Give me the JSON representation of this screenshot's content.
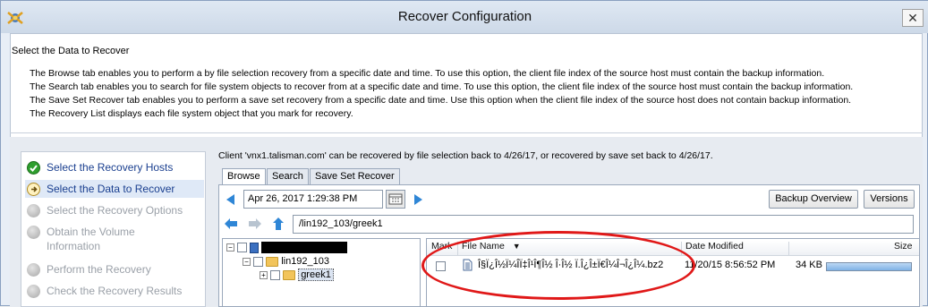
{
  "window": {
    "title": "Recover Configuration",
    "close_glyph": "✕"
  },
  "header": {
    "section_title": "Select the Data to Recover",
    "descriptions": [
      "The Browse tab enables you to perform a by file selection recovery from a specific date and time. To use this option, the client file index of the source host must contain the backup information.",
      "The Search tab enables you to search for file system objects to recover from at a specific date and time. To use this option, the client file index of the source host must contain the backup information.",
      "The Save Set Recover tab enables you to perform a save set recovery from a specific date and time.  Use this option when the client file index of the source host does not contain backup information.",
      "The Recovery List displays each file system object that you mark for recovery."
    ]
  },
  "steps": [
    {
      "label": "Select the Recovery Hosts",
      "state": "done",
      "icon": "check-circle-icon"
    },
    {
      "label": "Select the Data to Recover",
      "state": "active",
      "icon": "current-step-icon"
    },
    {
      "label": "Select the Recovery Options",
      "state": "disabled",
      "icon": "pending-step-icon"
    },
    {
      "label": "Obtain the Volume",
      "label2": "Information",
      "state": "disabled",
      "icon": "pending-step-icon"
    },
    {
      "label": "Perform the Recovery",
      "state": "disabled",
      "icon": "pending-step-icon"
    },
    {
      "label": "Check the Recovery Results",
      "state": "disabled",
      "icon": "pending-step-icon"
    }
  ],
  "client_info": "Client 'vnx1.talisman.com' can be recovered by file selection back to 4/26/17, or recovered by save set back to 4/26/17.",
  "tabs": {
    "browse": "Browse",
    "search": "Search",
    "saveset": "Save Set Recover"
  },
  "browse": {
    "datetime": "Apr 26, 2017 1:29:38 PM",
    "backup_overview_label": "Backup Overview",
    "versions_label": "Versions",
    "path": "/lin192_103/greek1"
  },
  "tree": {
    "root_label": "",
    "node1": "lin192_103",
    "node2": "greek1"
  },
  "file_table": {
    "headers": {
      "mark": "Mark",
      "file_name": "File Name",
      "date_modified": "Date Modified",
      "size": "Size"
    },
    "rows": [
      {
        "file_name": "Î§Ï¿Î½Ï¼Î­Ï‡Î¹Î¶Î½ Î·Î½ Ï.Î¿Î±Ï€Î¼Î¬Î¿Î¼.bz2",
        "date_modified": "11/20/15 8:56:52 PM",
        "size": "34 KB",
        "size_fill": 0.98
      }
    ]
  },
  "colors": {
    "step_link": "#1a3f8f",
    "step_disabled": "#9aa0a8",
    "annotation_oval": "#e01818",
    "nav_blue": "#2f86d6"
  }
}
